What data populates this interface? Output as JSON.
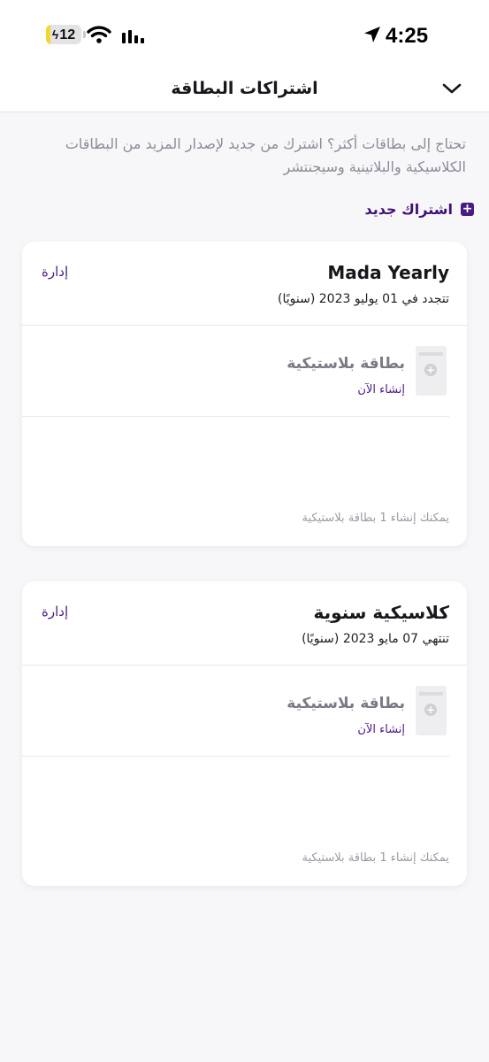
{
  "status_bar": {
    "battery_level": "12",
    "battery_fraction": 0.12,
    "time": "4:25"
  },
  "nav": {
    "title": "اشتراكات البطاقة"
  },
  "intro_text": "تحتاج إلى بطاقات أكثر؟ اشترك من جديد لإصدار المزيد من البطاقات الكلاسيكية والبلاتينية وسيجنتشر",
  "new_subscription_label": "اشتراك جديد",
  "subscriptions": [
    {
      "title": "Mada Yearly",
      "subtitle": "تتجدد في 01 يوليو 2023 (سنويًا)",
      "manage_label": "إدارة",
      "plastic_label": "بطاقة بلاستيكية",
      "create_label": "إنشاء الآن",
      "note": "يمكنك إنشاء 1 بطاقة بلاستيكية"
    },
    {
      "title": "كلاسيكية سنوية",
      "subtitle": "تنتهي 07 مايو 2023 (سنويًا)",
      "manage_label": "إدارة",
      "plastic_label": "بطاقة بلاستيكية",
      "create_label": "إنشاء الآن",
      "note": "يمكنك إنشاء 1 بطاقة بلاستيكية"
    }
  ],
  "colors": {
    "accent": "#4a1a86",
    "background": "#f7f7f9",
    "card": "#ffffff",
    "muted_text": "#8c8c99",
    "battery_fill": "#f5d52f"
  }
}
